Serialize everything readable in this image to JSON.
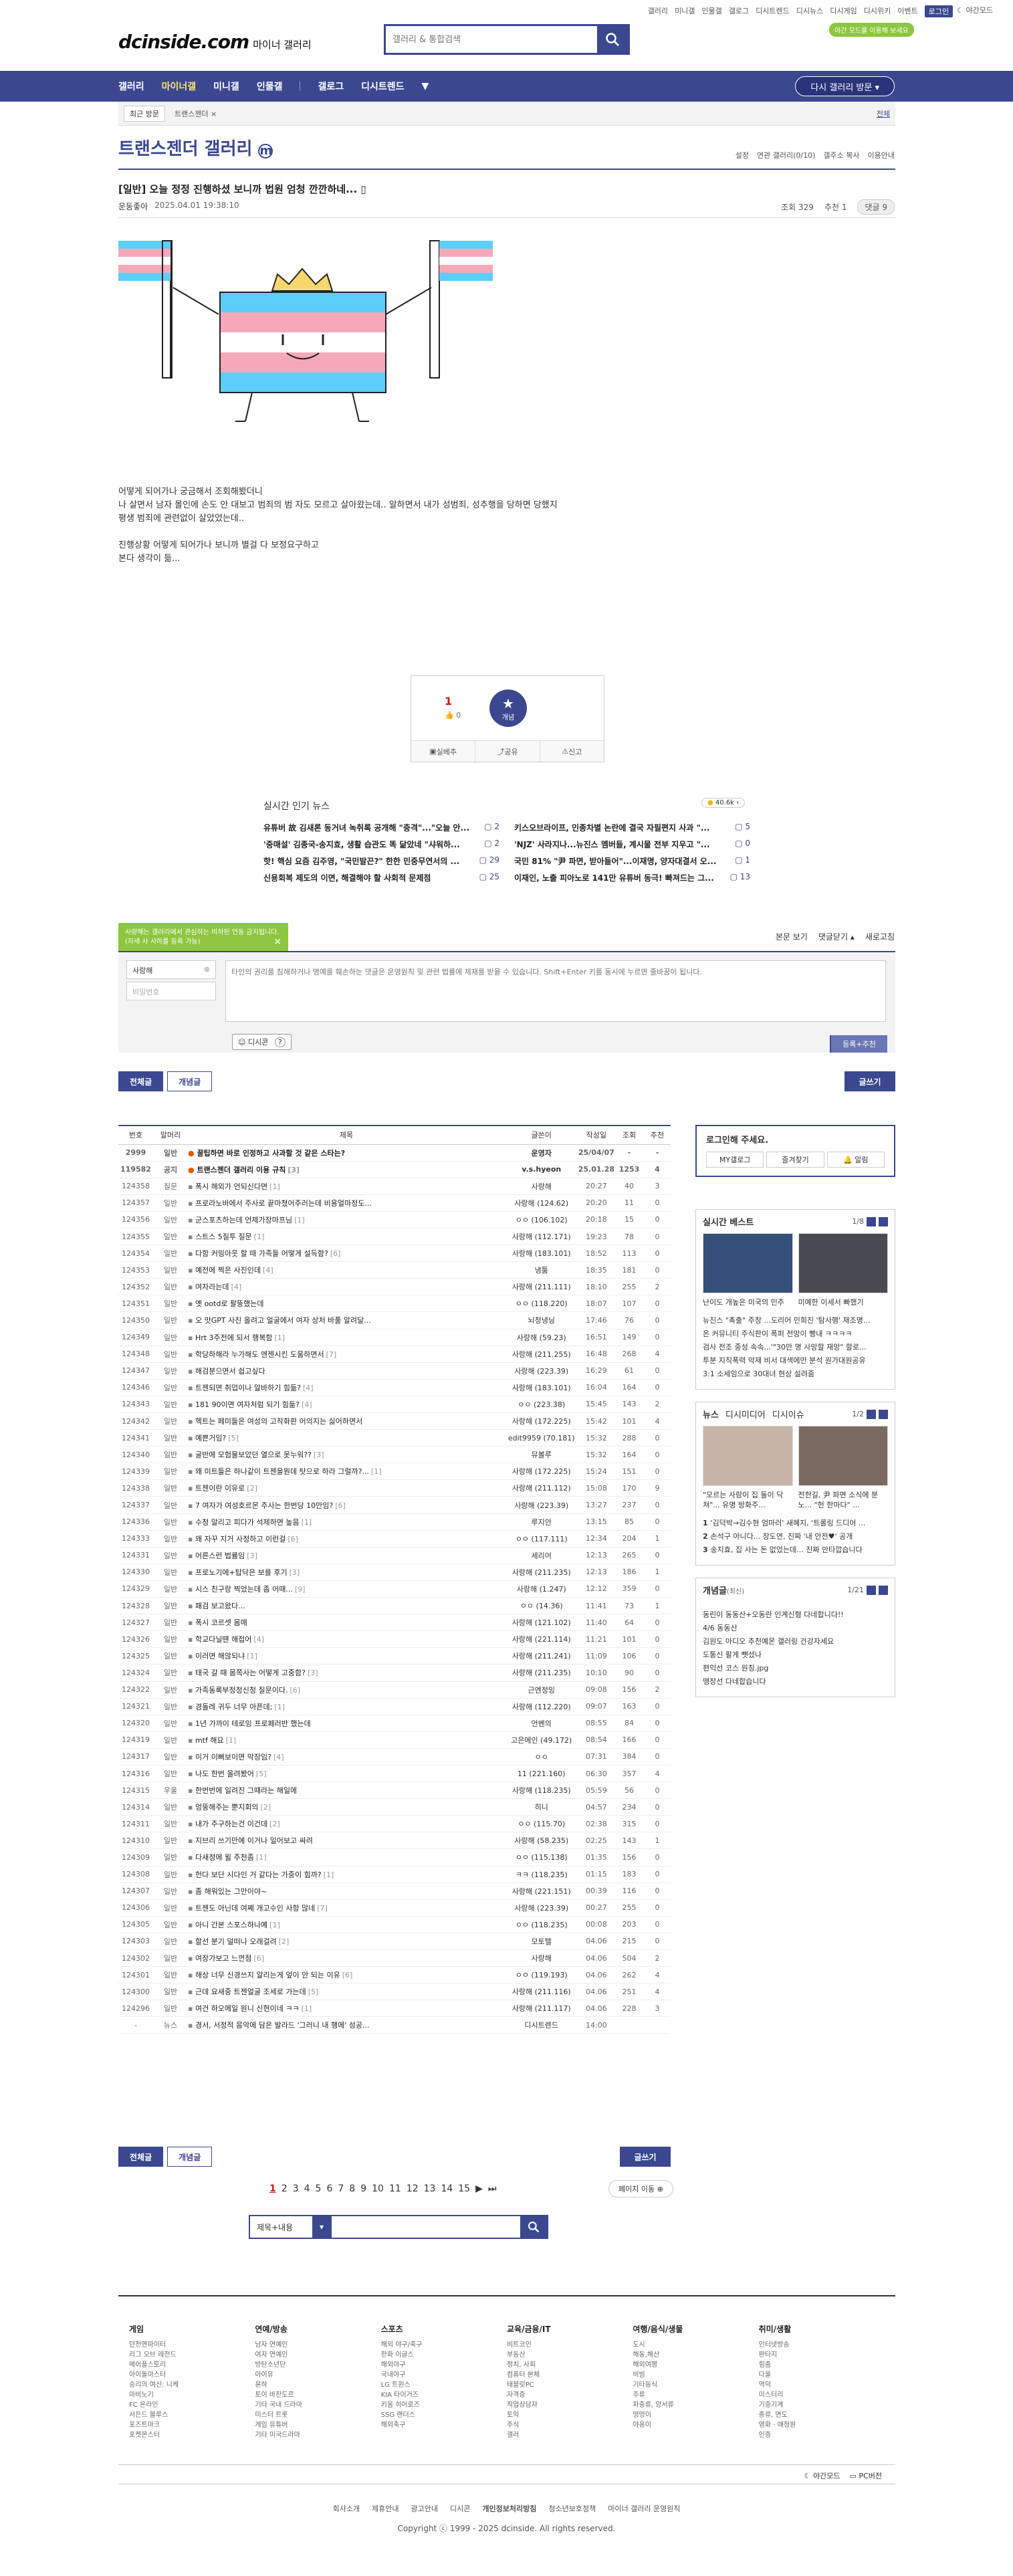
{
  "top_links": [
    "갤러리",
    "미니갤",
    "인물갤",
    "갤로그",
    "디시트렌드",
    "디시뉴스",
    "디시게임",
    "디시위키",
    "이벤트"
  ],
  "login_label": "로그인",
  "dark_mode": "야간모드",
  "logo_text": "dcinside.com",
  "logo_sub": "마이너 갤러리",
  "search": {
    "placeholder": "갤러리 & 통합검색"
  },
  "tooltip": "야간 모드를 이용해 보세요",
  "gnb": {
    "items": [
      "갤러리",
      "마이너갤",
      "미니갤",
      "인물갤",
      "갤로그",
      "디시트렌드"
    ],
    "active_index": 1,
    "revisit": "다시 갤러리 방문 ▾"
  },
  "subbar": {
    "recent": "최근 방문",
    "crumb": "트랜스젠더 ×",
    "all": "전체"
  },
  "gallery": {
    "title": "트랜스젠더 갤러리",
    "options": [
      "설정",
      "연관 갤러리(0/10)",
      "갤주소 복사",
      "이용안내"
    ]
  },
  "post": {
    "title": "[일반] 오늘 정정 진행하셨 보니까 법원 엄청 깐깐하네...",
    "author": "운동좋아",
    "date": "2025.04.01 19:38:10",
    "views": "조회 329",
    "recommends": "추천 1",
    "comments": "댓글 9",
    "body": [
      "어떻게 되어가나 궁금해서 조회해봤더니",
      "나 살면서 남자 몰인에 손도 안 대보고 범죄의 범 자도 모르고 살아왔는데.. 알하면서 내가 성범죄, 성추행을 당하면 당했지",
      "평생 범죄에 관련없이 살았었는데..",
      "",
      "진행상황 어떻게 되어가나 보니까 별걸 다 보정요구하고",
      "본다 생각이 듦..."
    ]
  },
  "vote": {
    "up_count": "1",
    "up_sub": "👍 0",
    "medal": "개념",
    "actions": [
      "실베추",
      "공유",
      "신고"
    ]
  },
  "news": {
    "heading": "실시간 인기 뉴스",
    "pill": "40.6k",
    "items": [
      {
        "t": "유튜버 故 김새론 동거녀 녹취록 공개해 \"충격\"...\"오늘 안...",
        "n": "2"
      },
      {
        "t": "키스오브라이프, 인종차별 논란에 결국 자필편지 사과 \"...",
        "n": "5"
      },
      {
        "t": "'중매설' 김종국-송지효, 생활 습관도 똑 닮았네 \"샤워하...",
        "n": "2"
      },
      {
        "t": "'NJZ' 사라지나...뉴진스 멤버들, 계시물 전부 지우고 \"...",
        "n": "0"
      },
      {
        "t": "핫! 핵심 요즘 김주영, \"국민발끈?\" 한한 민중무연서의 ...",
        "n": "29"
      },
      {
        "t": "국민 81% \"尹 파면, 받아들어\"...이재명, 양자대결서 오...",
        "n": "1"
      },
      {
        "t": "신용회복 제도의 이면, 해결해야 할 사회적 문제점",
        "n": "25"
      },
      {
        "t": "이재인, 노출 피아노로 141만 유튜버 동극! 빠져드는 그...",
        "n": "13"
      }
    ]
  },
  "comment": {
    "note": "사랑해는 갤러리에서 관심하는 비하된 언동 금지됩니다. (자세 사 사하를 등록 가능)",
    "controls": [
      "본문 보기",
      "댓글닫기 ▴",
      "새로고침"
    ],
    "nick": "사랑해",
    "pw_placeholder": "비밀번호",
    "placeholder": "타인의 권리를 침해하거나 명예를 훼손하는 댓글은 운영원칙 및 관련 법률에 제재를 받을 수 있습니다. Shift+Enter 키를 동시에 누르면 줄바꿈이 됩니다.",
    "dccon": "디시콘",
    "register": "등록",
    "register2": "등록+추천"
  },
  "tabs": {
    "all": "전체글",
    "best": "개념글",
    "write": "글쓰기"
  },
  "board": {
    "headers": [
      "번호",
      "말머리",
      "제목",
      "글쓴이",
      "작성일",
      "조회",
      "추천"
    ],
    "rows": [
      [
        "2999",
        "일반",
        "꿀팁하면 바로 인정하고 사과할 것 같은 스타는?",
        "",
        "운영자",
        "25/04/07",
        "-",
        "-"
      ],
      [
        "119582",
        "공지",
        "트랜스젠더 갤러리 이용 규칙",
        "3",
        "v.s.hyeon",
        "25.01.28",
        "1253",
        "4"
      ],
      [
        "124358",
        "질문",
        "폭시 해외가 언되신다면",
        "1",
        "사랑해",
        "20:27",
        "40",
        "3"
      ],
      [
        "124357",
        "일반",
        "프로라노바에서 주사로 끝마쳤어주러는데 비용얼마정도...",
        "",
        "사랑해 (124.62)",
        "20:20",
        "11",
        "0"
      ],
      [
        "124356",
        "일반",
        "군스포츠하는데 언제가장마프님",
        "1",
        "ㅇㅇ (106.102)",
        "20:18",
        "15",
        "0"
      ],
      [
        "124355",
        "일반",
        "스트스 5질투 질문",
        "1",
        "사랑해 (112.171)",
        "19:23",
        "78",
        "0"
      ],
      [
        "124354",
        "일반",
        "다함 커밍아웃 할 때 가족들 어떻게 설득함?",
        "6",
        "사랑해 (183.101)",
        "18:52",
        "113",
        "0"
      ],
      [
        "124353",
        "일반",
        "예전에 찍은 사진인데",
        "4",
        "냉툼",
        "18:35",
        "181",
        "0"
      ],
      [
        "124352",
        "일반",
        "여자라는데",
        "4",
        "사랑해 (211.111)",
        "18:10",
        "255",
        "2"
      ],
      [
        "124351",
        "일반",
        "옛 ootd로 팔뚱했는데",
        "",
        "ㅇㅇ (118.220)",
        "18:07",
        "107",
        "0"
      ],
      [
        "124350",
        "일반",
        "오 맛GPT 사진 올려고 얼굴에서 여자 상처 바풀 알려달...",
        "",
        "뇌청냉닝",
        "17:46",
        "76",
        "0"
      ],
      [
        "124349",
        "일반",
        "Hrt 3주전에 되서 행복함",
        "1",
        "사랑해 (59.23)",
        "16:51",
        "149",
        "0"
      ],
      [
        "124348",
        "일반",
        "학당하해라 누가해도 엔젠시킨 도움하면서",
        "7",
        "사랑해 (211.255)",
        "16:48",
        "268",
        "4"
      ],
      [
        "124347",
        "일반",
        "해검분으면서 쉽고싶다",
        "",
        "사랑해 (223.39)",
        "16:29",
        "61",
        "0"
      ],
      [
        "124346",
        "일반",
        "트젠되면 취업이나 알바하기 힘듦?",
        "4",
        "사랑해 (183.101)",
        "16:04",
        "164",
        "0"
      ],
      [
        "124343",
        "일반",
        "181 90이면 여자처럼 되기 힘듦?",
        "4",
        "ㅇㅇ (223.38)",
        "15:45",
        "143",
        "2"
      ],
      [
        "124342",
        "일반",
        "헥트는 페미들은 여성의 고작화판 어의지는 싫어하면서",
        "",
        "사랑해 (172.225)",
        "15:42",
        "101",
        "4"
      ],
      [
        "124341",
        "일반",
        "예쁜거임?",
        "5",
        "edit9959 (70.181)",
        "15:32",
        "288",
        "0"
      ],
      [
        "124340",
        "일반",
        "굴반에 모험물보았던 열으로 못누워??",
        "3",
        "뮤볼루",
        "15:32",
        "164",
        "0"
      ],
      [
        "124339",
        "일반",
        "왜 미트들은 하나같이 트젠을뭔데 탓으로 하라 그럴까?...",
        "1",
        "사랑해 (172.225)",
        "15:24",
        "151",
        "0"
      ],
      [
        "124338",
        "일반",
        "트젠이란 이유로",
        "2",
        "사랑해 (211.112)",
        "15:08",
        "170",
        "9"
      ],
      [
        "124337",
        "일반",
        "7 여자가 여성호르몬 주사는 한번당 10만임?",
        "6",
        "사랑해 (223.39)",
        "13:27",
        "237",
        "0"
      ],
      [
        "124336",
        "일반",
        "수청 알리고 피다가 석제하면 높음",
        "1",
        "루지안",
        "13:15",
        "85",
        "0"
      ],
      [
        "124333",
        "일반",
        "왜 자꾸 지거 사정하고 이런걸",
        "6",
        "ㅇㅇ (117.111)",
        "12:34",
        "204",
        "1"
      ],
      [
        "124331",
        "일반",
        "어른스런 법률임",
        "3",
        "세리어",
        "12:13",
        "265",
        "0"
      ],
      [
        "124330",
        "일반",
        "프로노기에+탑닥은 보를 후기",
        "3",
        "사랑해 (211.235)",
        "12:13",
        "186",
        "1"
      ],
      [
        "124329",
        "일반",
        "시스 친구랑 찍었는데 좀 어때...",
        "9",
        "사랑해 (1.247)",
        "12:12",
        "359",
        "0"
      ],
      [
        "124328",
        "일반",
        "패검 보고왔다...",
        "",
        "ㅇㅇ (14.36)",
        "11:41",
        "73",
        "1"
      ],
      [
        "124327",
        "일반",
        "폭시 코르셋 몸매",
        "",
        "사랑해 (121.102)",
        "11:40",
        "64",
        "0"
      ],
      [
        "124326",
        "일반",
        "학교다닐떈 해접어",
        "4",
        "사랑해 (221.114)",
        "11:21",
        "101",
        "0"
      ],
      [
        "124325",
        "일반",
        "이러면 해않되냐",
        "1",
        "사랑해 (211.241)",
        "11:09",
        "106",
        "0"
      ],
      [
        "124324",
        "일반",
        "태국 갈 때 몸쪽사는 어떻게 고중함?",
        "3",
        "사랑해 (211.235)",
        "10:10",
        "90",
        "0"
      ],
      [
        "124322",
        "일반",
        "가족동록부정정신청 질문이다.",
        "6",
        "근엔정잉",
        "09:08",
        "156",
        "2"
      ],
      [
        "124321",
        "일반",
        "경돌레 귀두 너무 아픈데;",
        "1",
        "사랑해 (112.220)",
        "09:07",
        "163",
        "0"
      ],
      [
        "124320",
        "일반",
        "1년 가까이 테로잉 프로페러반 했는데",
        "",
        "언벤의",
        "08:55",
        "84",
        "0"
      ],
      [
        "124319",
        "일반",
        "mtf 해요",
        "1",
        "고은에인 (49.172)",
        "08:54",
        "166",
        "0"
      ],
      [
        "124317",
        "일반",
        "이거 이뻐보이면 막장임?",
        "4",
        "ㅇㅇ",
        "07:31",
        "384",
        "0"
      ],
      [
        "124316",
        "일반",
        "나도 한번 올려봤어",
        "5",
        "11 (221.160)",
        "06:30",
        "357",
        "4"
      ],
      [
        "124315",
        "우울",
        "한번번에 일려진 그때라는 해일에",
        "",
        "사랑해 (118.235)",
        "05:59",
        "56",
        "0"
      ],
      [
        "124314",
        "일반",
        "엉뚱해주는 뿐지회의",
        "2",
        "히니",
        "04:57",
        "234",
        "0"
      ],
      [
        "124311",
        "일반",
        "내가 주구하는건 이건데",
        "2",
        "ㅇㅇ (115.70)",
        "02:38",
        "315",
        "0"
      ],
      [
        "124310",
        "일반",
        "지브리 쓰기만에 이거나 일어보고 싸려",
        "",
        "사랑해 (58.235)",
        "02:25",
        "143",
        "1"
      ],
      [
        "124309",
        "일반",
        "다새정에 윌 주천좀",
        "1",
        "ㅇㅇ (115.138)",
        "01:35",
        "156",
        "0"
      ],
      [
        "124308",
        "일반",
        "헌다 보단 시다인 거 같다는 가중이 힘까?",
        "1",
        "ㅋㅋ (118.235)",
        "01:15",
        "183",
        "0"
      ],
      [
        "124307",
        "일반",
        "좀 해워있는 그만이야~",
        "",
        "사랑해 (221.151)",
        "00:39",
        "116",
        "0"
      ],
      [
        "124306",
        "일반",
        "트젠도 아닌데 여쩨 개고수인 사항 많네",
        "7",
        "사랑해 (223.39)",
        "00:27",
        "255",
        "0"
      ],
      [
        "124305",
        "일반",
        "아니 간본 스포스하나예",
        "1",
        "ㅇㅇ (118.235)",
        "00:08",
        "203",
        "0"
      ],
      [
        "124303",
        "일반",
        "할선 분기 덜떠나 오래걸려",
        "2",
        "모토텔",
        "04.06",
        "215",
        "0"
      ],
      [
        "124302",
        "일반",
        "여장가보고 느껀점",
        "6",
        "사랑해",
        "04.06",
        "504",
        "2"
      ],
      [
        "124301",
        "일반",
        "해상 너무 신경쓰지 알리는게 엎이 안 되는 이유",
        "6",
        "ㅇㅇ (119.193)",
        "04.06",
        "262",
        "4"
      ],
      [
        "124300",
        "일반",
        "근데 요새중 트젠얼굴 조세로 가는데",
        "5",
        "사랑해 (211.116)",
        "04.06",
        "251",
        "4"
      ],
      [
        "124296",
        "일반",
        "여건 하오메일 원니 신현이네 ㅋㅋ",
        "1",
        "사랑해 (211.117)",
        "04.06",
        "228",
        "3"
      ],
      [
        "-",
        "뉴스",
        "경서, 서정적 음악에 담은 발라드 '그러니 내 행에' 성공...",
        "",
        "디시트렌드",
        "14:00",
        "",
        ""
      ]
    ]
  },
  "pager": {
    "pages": [
      "1",
      "2",
      "3",
      "4",
      "5",
      "6",
      "7",
      "8",
      "9",
      "10",
      "11",
      "12",
      "13",
      "14",
      "15"
    ],
    "current": "1",
    "next": "▶",
    "last": "⏭",
    "skip": "페이지 이동 ⊕"
  },
  "bottom_search": {
    "select": "제목+내용"
  },
  "side": {
    "login_title": "로그인해 주세요.",
    "login_btns": [
      "MY갤로그",
      "즐겨찾기",
      "🔔 알림"
    ],
    "best_title": "실시간 베스트",
    "best_page": "1/8",
    "best_caps": [
      "난이도 개높은 미국의 민주",
      "미예한 이세서 빠했기"
    ],
    "best_list": [
      "뉴진스 \"촉출\" 주창 ...도리어 민희진 '탐사행' 재조명...",
      "온 커뮤니티 주식판이 폭퍼 전망이 빵내 ㅋㅋㅋㅋ",
      "검사 전조 중성 속속...'\"30만 명 사망할 재앙\" 할로...",
      "투분 지직폭력 악재 비서 대색에만 분석 원가대원공유",
      "3:1 소세임으로 30대녀 현상 설려줌"
    ],
    "news_tabs": [
      "뉴스",
      "디시미디어",
      "디시이슈"
    ],
    "news_page": "1/2",
    "news_caps": [
      "\"모르는 사람이 집 돌이 닥쳐\"... 유명 방화주...",
      "전한길, 尹 파면 소식에 분노... \"헌 한마다\" ..."
    ],
    "news_list": [
      "'김덕박→김수현 엄마러' 새혜지, '트롤링 드디어 ...",
      "손석구 아니다... 장도연, 진짜 '내 안전♥' 공개",
      "송지효, 집 사는 돈 없었는데... 진짜 안타깝습니다"
    ],
    "concept_title": "개념글",
    "concept_sub": "(최신)",
    "concept_page": "1/21",
    "concept_list": [
      "동린이 동동산+오동란 인계신형 다네합니다!!",
      "4/6 동동산",
      "김원도 아디오 추천예몬 갤러링 건강자세요",
      "도통신 팔게 뺏셨나",
      "편익선 코스 원칭.jpg",
      "맹장선 다네합습니다"
    ]
  },
  "footer": {
    "cols": [
      {
        "h": "게임",
        "items": [
          "던전앤파이터",
          "리그 오브 레전드",
          "메이플스토리",
          "아이돌마스터",
          "승리의 여신: 니케",
          "마비노기",
          "FC 온라인",
          "서든드 블루스",
          "포즈트마크",
          "포켓몬스터"
        ]
      },
      {
        "h": "연예/방송",
        "items": [
          "남자 연예인",
          "여자 연예인",
          "방탄소년단",
          "아이유",
          "윤하",
          "토이 바찬도르",
          "기타 국내 드라마",
          "미스터 트롯",
          "게임 유튜버",
          "기타 미국드라마"
        ]
      },
      {
        "h": "스포츠",
        "items": [
          "해외 야구/축구",
          "한화 이글스",
          "해외야구",
          "국내야구",
          "LG 트윈스",
          "KIA 타이거즈",
          "키움 히어로즈",
          "SSG 랜더스",
          "해외축구"
        ]
      },
      {
        "h": "교육/금융/IT",
        "items": [
          "비트코인",
          "부동산",
          "정치, 사회",
          "컴퓨터 본체",
          "태블릿PC",
          "자격증",
          "직업상담자",
          "토익",
          "주식",
          "갤러"
        ]
      },
      {
        "h": "여행/음식/생물",
        "items": [
          "도시",
          "해동,해산",
          "해외여행",
          "비빔",
          "기타동식",
          "주류",
          "파충류, 양서류",
          "멍멍이",
          "야옹이"
        ]
      },
      {
        "h": "취미/생활",
        "items": [
          "인터넷방송",
          "판타지",
          "힘줌",
          "다올",
          "역덕",
          "미스터리",
          "기중기계",
          "종류, 면도",
          "영화 · 애청원",
          "인증"
        ]
      }
    ],
    "mode": [
      "야간모드",
      "PC버전"
    ],
    "links": [
      "회사소개",
      "제휴안내",
      "광고안내",
      "디시콘",
      "개인정보처리방침",
      "청소년보호정책",
      "마이너 갤러리 운영원칙"
    ],
    "copyright": "Copyright ⓒ 1999 - 2025 dcinside. All rights reserved."
  },
  "colors": {
    "brand": "#3b4890",
    "accent_red": "#d31900",
    "green": "#8dc63f",
    "trans_blue": "#5bcefa",
    "trans_pink": "#f5a9b8"
  }
}
